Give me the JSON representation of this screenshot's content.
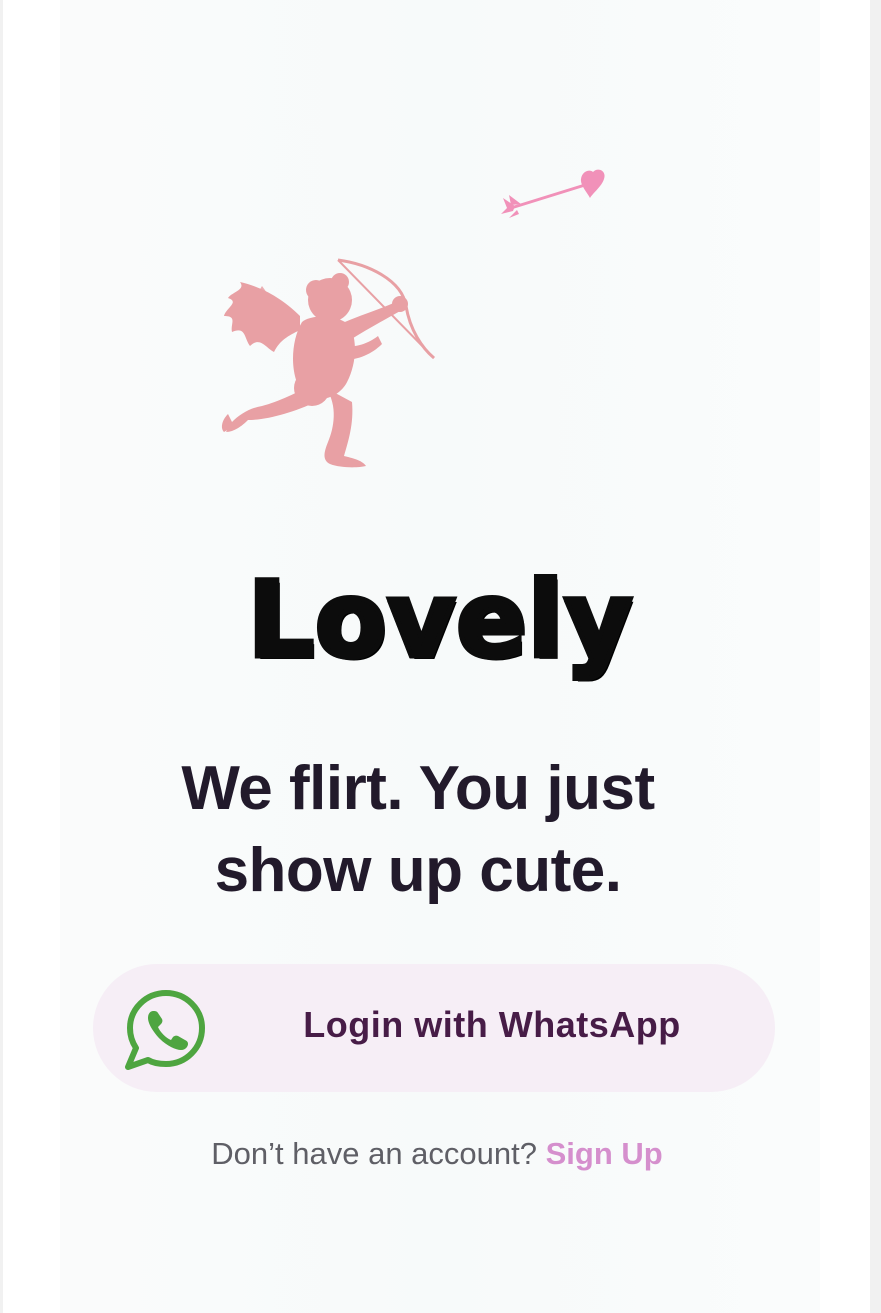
{
  "branding": {
    "app_name": "Lovely"
  },
  "illustrations": {
    "top_art": "cupid-icon",
    "flying_arrow": "heart-arrow-icon"
  },
  "hero": {
    "line1": "We flirt. You just",
    "line2": "show up cute."
  },
  "login": {
    "whatsapp_label": "Login with WhatsApp",
    "icon": "whatsapp-icon"
  },
  "signup": {
    "prompt": "Don’t have an account? ",
    "link_label": "Sign Up"
  },
  "colors": {
    "background": "#f9fbfb",
    "cupid": "#e8a0a4",
    "arrow": "#f191b9",
    "headline": "#221a2b",
    "button_bg": "#f6eef6",
    "button_text": "#471c47",
    "whatsapp_green": "#4ea540",
    "signup_link": "#d58fcd",
    "muted_text": "#5f5f66"
  }
}
